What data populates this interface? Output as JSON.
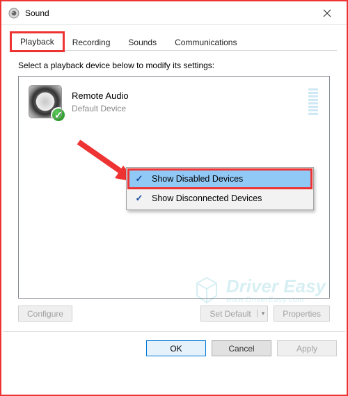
{
  "window": {
    "title": "Sound"
  },
  "tabs": {
    "playback": "Playback",
    "recording": "Recording",
    "sounds": "Sounds",
    "communications": "Communications"
  },
  "instruction": "Select a playback device below to modify its settings:",
  "device": {
    "name": "Remote Audio",
    "status": "Default Device"
  },
  "context_menu": {
    "show_disabled": "Show Disabled Devices",
    "show_disconnected": "Show Disconnected Devices"
  },
  "buttons": {
    "configure": "Configure",
    "set_default": "Set Default",
    "properties": "Properties",
    "ok": "OK",
    "cancel": "Cancel",
    "apply": "Apply"
  },
  "watermark": {
    "brand": "Driver Easy",
    "url": "www.DriverEasy.com"
  }
}
